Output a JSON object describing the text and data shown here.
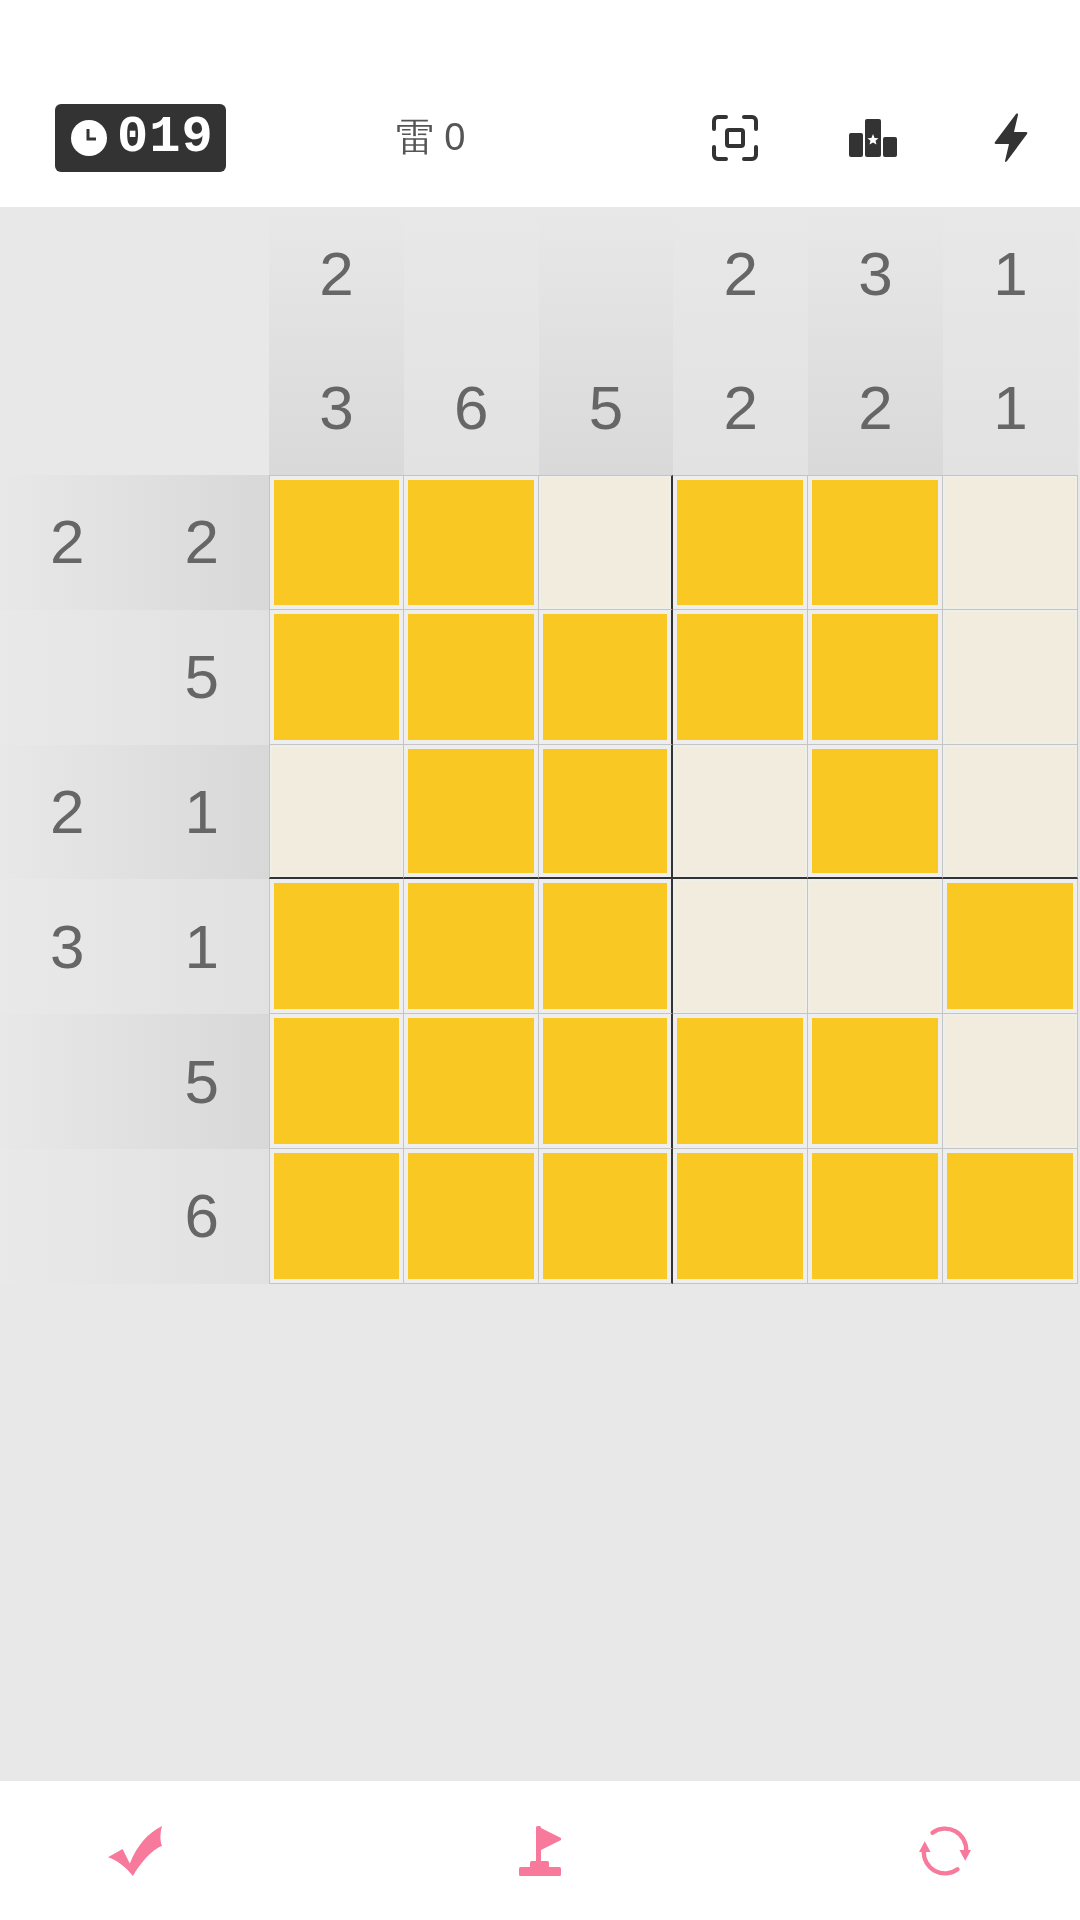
{
  "top_bar": {
    "timer": "019",
    "mine_count": "雷 0"
  },
  "column_clues": [
    [
      "2",
      "3"
    ],
    [
      "6"
    ],
    [
      "5"
    ],
    [
      "2",
      "2"
    ],
    [
      "3",
      "2"
    ],
    [
      "1",
      "1"
    ]
  ],
  "row_clues": [
    [
      "2",
      "2"
    ],
    [
      "5"
    ],
    [
      "2",
      "1"
    ],
    [
      "3",
      "1"
    ],
    [
      "5"
    ],
    [
      "6"
    ]
  ],
  "grid": [
    [
      {
        "filled": true
      },
      {
        "filled": true
      },
      {
        "filled": false
      },
      {
        "filled": true
      },
      {
        "filled": true
      },
      {
        "filled": false
      }
    ],
    [
      {
        "filled": true
      },
      {
        "filled": true
      },
      {
        "filled": true
      },
      {
        "filled": true
      },
      {
        "filled": true
      },
      {
        "filled": false
      }
    ],
    [
      {
        "filled": false
      },
      {
        "filled": true
      },
      {
        "filled": true
      },
      {
        "filled": false
      },
      {
        "filled": true
      },
      {
        "filled": false
      }
    ],
    [
      {
        "filled": true
      },
      {
        "filled": true
      },
      {
        "filled": true
      },
      {
        "filled": false
      },
      {
        "filled": false
      },
      {
        "filled": true
      }
    ],
    [
      {
        "filled": true
      },
      {
        "filled": true
      },
      {
        "filled": true
      },
      {
        "filled": true
      },
      {
        "filled": true
      },
      {
        "filled": false
      }
    ],
    [
      {
        "filled": true
      },
      {
        "filled": true
      },
      {
        "filled": true
      },
      {
        "filled": true
      },
      {
        "filled": true
      },
      {
        "filled": true
      }
    ]
  ]
}
